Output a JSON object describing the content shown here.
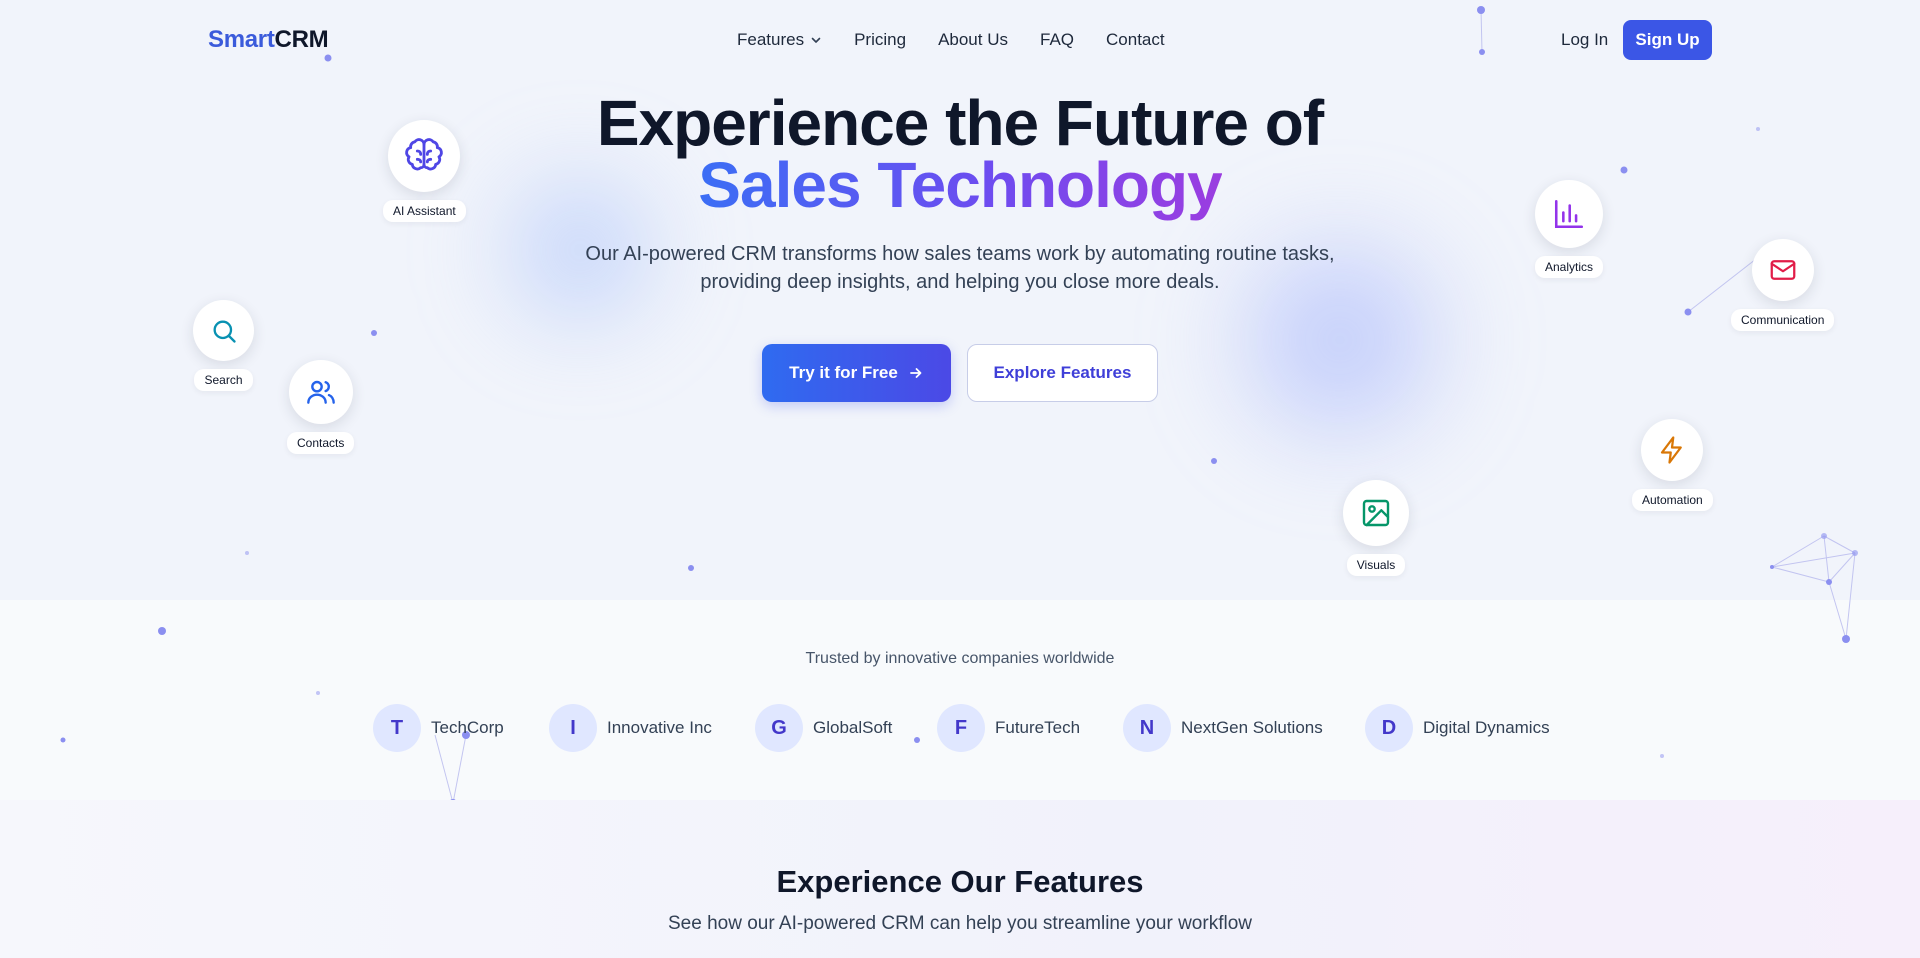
{
  "brand": {
    "logo_part1": "Smart",
    "logo_part2": "CRM"
  },
  "nav": {
    "items": [
      {
        "label": "Features",
        "has_dropdown": true
      },
      {
        "label": "Pricing"
      },
      {
        "label": "About Us"
      },
      {
        "label": "FAQ"
      },
      {
        "label": "Contact"
      }
    ],
    "login_label": "Log In",
    "signup_label": "Sign Up"
  },
  "hero": {
    "title_line1": "Experience the Future of",
    "title_line2": "Sales Technology",
    "subtitle_line1": "Our AI-powered CRM transforms how sales teams work by automating routine tasks,",
    "subtitle_line2": "providing deep insights, and helping you close more deals.",
    "cta_primary": "Try it for Free",
    "cta_secondary": "Explore Features"
  },
  "floating_features": [
    {
      "label": "AI Assistant",
      "icon": "brain-icon",
      "color": "#4f46e5"
    },
    {
      "label": "Search",
      "icon": "search-icon",
      "color": "#0891b2"
    },
    {
      "label": "Contacts",
      "icon": "users-icon",
      "color": "#2563eb"
    },
    {
      "label": "Analytics",
      "icon": "bar-chart-icon",
      "color": "#9333ea"
    },
    {
      "label": "Communication",
      "icon": "mail-icon",
      "color": "#e11d48"
    },
    {
      "label": "Automation",
      "icon": "lightning-icon",
      "color": "#d97706"
    },
    {
      "label": "Visuals",
      "icon": "image-icon",
      "color": "#059669"
    }
  ],
  "trusted": {
    "heading": "Trusted by innovative companies worldwide",
    "companies": [
      {
        "initial": "T",
        "name": "TechCorp"
      },
      {
        "initial": "I",
        "name": "Innovative Inc"
      },
      {
        "initial": "G",
        "name": "GlobalSoft"
      },
      {
        "initial": "F",
        "name": "FutureTech"
      },
      {
        "initial": "N",
        "name": "NextGen Solutions"
      },
      {
        "initial": "D",
        "name": "Digital Dynamics"
      }
    ]
  },
  "features_section": {
    "title": "Experience Our Features",
    "subtitle": "See how our AI-powered CRM can help you streamline your workflow"
  },
  "colors": {
    "accent": "#3b56e6",
    "brand_blue": "#3b5bdb",
    "dot": "#8b8ff0"
  }
}
